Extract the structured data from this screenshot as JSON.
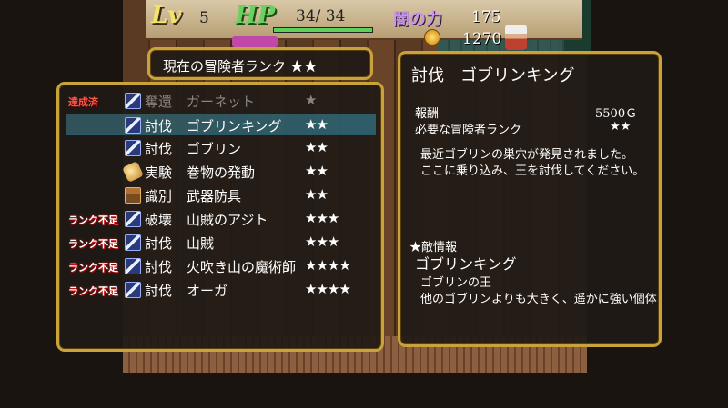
{
  "hud": {
    "lv_label": "Lv",
    "lv_value": "5",
    "hp_label": "HP",
    "hp_value": "34/  34",
    "hp_fraction": 1.0,
    "dark_label": "闇の力",
    "dark_value": "175",
    "gold_value": "1270"
  },
  "rank": {
    "text": "現在の冒険者ランク ★★"
  },
  "quests": [
    {
      "status": "達成済",
      "icon": "sword-icon",
      "category": "奪還",
      "name": "ガーネット",
      "stars": "★",
      "dim": true,
      "selected": false
    },
    {
      "status": "",
      "icon": "sword-icon",
      "category": "討伐",
      "name": "ゴブリンキング",
      "stars": "★★",
      "dim": false,
      "selected": true
    },
    {
      "status": "",
      "icon": "sword-icon",
      "category": "討伐",
      "name": "ゴブリン",
      "stars": "★★",
      "dim": false,
      "selected": false
    },
    {
      "status": "",
      "icon": "scroll-icon",
      "category": "実験",
      "name": "巻物の発動",
      "stars": "★★",
      "dim": false,
      "selected": false
    },
    {
      "status": "",
      "icon": "chest-icon",
      "category": "識別",
      "name": "武器防具",
      "stars": "★★",
      "dim": false,
      "selected": false
    },
    {
      "status": "ランク不足",
      "icon": "sword-icon",
      "category": "破壊",
      "name": "山賊のアジト",
      "stars": "★★★",
      "dim": false,
      "selected": false
    },
    {
      "status": "ランク不足",
      "icon": "sword-icon",
      "category": "討伐",
      "name": "山賊",
      "stars": "★★★",
      "dim": false,
      "selected": false
    },
    {
      "status": "ランク不足",
      "icon": "sword-icon",
      "category": "討伐",
      "name": "火吹き山の魔術師",
      "stars": "★★★★",
      "dim": false,
      "selected": false
    },
    {
      "status": "ランク不足",
      "icon": "sword-icon",
      "category": "討伐",
      "name": "オーガ",
      "stars": "★★★★",
      "dim": false,
      "selected": false
    }
  ],
  "detail": {
    "title": "討伐　ゴブリンキング",
    "reward_label": "報酬",
    "reward_value": "5500Ｇ",
    "rank_label": "必要な冒険者ランク",
    "rank_value": "★★",
    "desc_line1": "最近ゴブリンの巣穴が発見されました。",
    "desc_line2": "ここに乗り込み、王を討伐してください。",
    "enemy_header": "★敵情報",
    "enemy_name": "ゴブリンキング",
    "enemy_desc1": "ゴブリンの王",
    "enemy_desc2": "他のゴブリンよりも大きく、遥かに強い個体"
  },
  "colors": {
    "border_gold": "#c9a23a",
    "selection": "#4696aa",
    "status_red": "#ff5a4a"
  }
}
